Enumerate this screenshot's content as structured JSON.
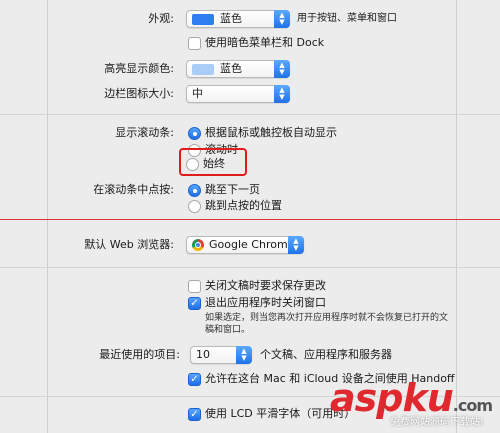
{
  "appearance": {
    "label": "外观:",
    "value": "蓝色",
    "hint": "用于按钮、菜单和窗口",
    "swatch_color": "#2f7df0",
    "dark_menu_label": "使用暗色菜单栏和 Dock",
    "dark_menu_checked": false
  },
  "highlight": {
    "label": "高亮显示颜色:",
    "value": "蓝色",
    "swatch_color": "#a9cdf7"
  },
  "sidebar_icon": {
    "label": "边栏图标大小:",
    "value": "中"
  },
  "scrollbars": {
    "label": "显示滚动条:",
    "options": [
      "根据鼠标或触控板自动显示",
      "滚动时",
      "始终"
    ],
    "selected": 0
  },
  "scroll_click": {
    "label": "在滚动条中点按:",
    "options": [
      "跳至下一页",
      "跳到点按的位置"
    ],
    "selected": 0
  },
  "browser": {
    "label": "默认 Web 浏览器:",
    "value": "Google Chrome"
  },
  "documents": {
    "ask_save_label": "关闭文稿时要求保存更改",
    "ask_save_checked": false,
    "close_windows_label": "退出应用程序时关闭窗口",
    "close_windows_checked": true,
    "note_line1": "如果选定，则当您再次打开应用程序时就不会恢复已打开的文",
    "note_line2": "稿和窗口。"
  },
  "recent": {
    "label": "最近使用的项目:",
    "value": "10",
    "suffix": "个文稿、应用程序和服务器"
  },
  "handoff": {
    "label": "允许在这台 Mac 和 iCloud 设备之间使用 Handoff",
    "checked": true
  },
  "lcd": {
    "label": "使用 LCD 平滑字体（可用时）",
    "checked": true
  },
  "watermark": {
    "brand": "aspku",
    "suffix": ".com",
    "tagline": "免费网站源码下载站!"
  },
  "colors": {
    "accent": "#1f72e8",
    "highlight_box": "#e21c1c",
    "red_line": "#e0333a"
  }
}
